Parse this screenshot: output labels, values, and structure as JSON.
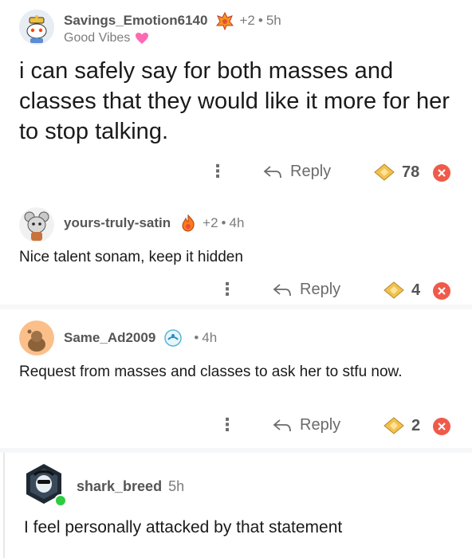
{
  "comments": [
    {
      "username": "Savings_Emotion6140",
      "flair": "Good Vibes",
      "awards": "+2",
      "age": "5h",
      "text": "i can safely say for both masses and classes that they would like it more for her to stop talking.",
      "reply_label": "Reply",
      "award_count": "78"
    },
    {
      "username": "yours-truly-satin",
      "awards": "+2",
      "age": "4h",
      "text": "Nice talent sonam, keep it hidden",
      "reply_label": "Reply",
      "award_count": "4"
    },
    {
      "username": "Same_Ad2009",
      "age": "4h",
      "text": "Request from masses and classes to ask her to stfu now.",
      "reply_label": "Reply",
      "award_count": "2"
    },
    {
      "username": "shark_breed",
      "age": "5h",
      "text": "I feel personally attacked by that statement"
    }
  ],
  "colors": {
    "accent_red": "#f05a4a",
    "award_gold": "#f2c14e",
    "online_green": "#2ecc40"
  },
  "icons": [
    "more-vertical-icon",
    "reply-arrow-icon",
    "award-icon",
    "close-icon",
    "heart-icon",
    "fire-award-icon"
  ]
}
